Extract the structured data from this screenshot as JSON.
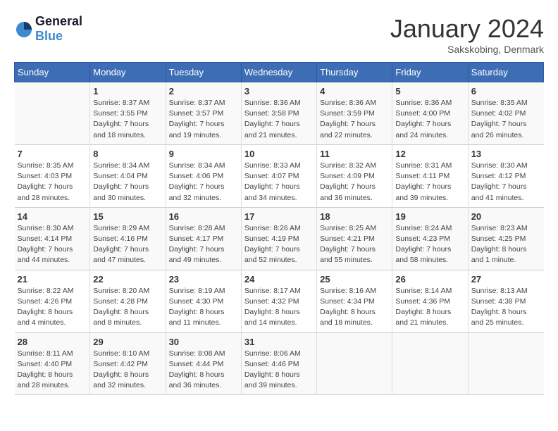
{
  "header": {
    "logo_general": "General",
    "logo_blue": "Blue",
    "month": "January 2024",
    "location": "Sakskobing, Denmark"
  },
  "weekdays": [
    "Sunday",
    "Monday",
    "Tuesday",
    "Wednesday",
    "Thursday",
    "Friday",
    "Saturday"
  ],
  "weeks": [
    [
      {
        "day": "",
        "info": ""
      },
      {
        "day": "1",
        "info": "Sunrise: 8:37 AM\nSunset: 3:55 PM\nDaylight: 7 hours\nand 18 minutes."
      },
      {
        "day": "2",
        "info": "Sunrise: 8:37 AM\nSunset: 3:57 PM\nDaylight: 7 hours\nand 19 minutes."
      },
      {
        "day": "3",
        "info": "Sunrise: 8:36 AM\nSunset: 3:58 PM\nDaylight: 7 hours\nand 21 minutes."
      },
      {
        "day": "4",
        "info": "Sunrise: 8:36 AM\nSunset: 3:59 PM\nDaylight: 7 hours\nand 22 minutes."
      },
      {
        "day": "5",
        "info": "Sunrise: 8:36 AM\nSunset: 4:00 PM\nDaylight: 7 hours\nand 24 minutes."
      },
      {
        "day": "6",
        "info": "Sunrise: 8:35 AM\nSunset: 4:02 PM\nDaylight: 7 hours\nand 26 minutes."
      }
    ],
    [
      {
        "day": "7",
        "info": "Sunrise: 8:35 AM\nSunset: 4:03 PM\nDaylight: 7 hours\nand 28 minutes."
      },
      {
        "day": "8",
        "info": "Sunrise: 8:34 AM\nSunset: 4:04 PM\nDaylight: 7 hours\nand 30 minutes."
      },
      {
        "day": "9",
        "info": "Sunrise: 8:34 AM\nSunset: 4:06 PM\nDaylight: 7 hours\nand 32 minutes."
      },
      {
        "day": "10",
        "info": "Sunrise: 8:33 AM\nSunset: 4:07 PM\nDaylight: 7 hours\nand 34 minutes."
      },
      {
        "day": "11",
        "info": "Sunrise: 8:32 AM\nSunset: 4:09 PM\nDaylight: 7 hours\nand 36 minutes."
      },
      {
        "day": "12",
        "info": "Sunrise: 8:31 AM\nSunset: 4:11 PM\nDaylight: 7 hours\nand 39 minutes."
      },
      {
        "day": "13",
        "info": "Sunrise: 8:30 AM\nSunset: 4:12 PM\nDaylight: 7 hours\nand 41 minutes."
      }
    ],
    [
      {
        "day": "14",
        "info": "Sunrise: 8:30 AM\nSunset: 4:14 PM\nDaylight: 7 hours\nand 44 minutes."
      },
      {
        "day": "15",
        "info": "Sunrise: 8:29 AM\nSunset: 4:16 PM\nDaylight: 7 hours\nand 47 minutes."
      },
      {
        "day": "16",
        "info": "Sunrise: 8:28 AM\nSunset: 4:17 PM\nDaylight: 7 hours\nand 49 minutes."
      },
      {
        "day": "17",
        "info": "Sunrise: 8:26 AM\nSunset: 4:19 PM\nDaylight: 7 hours\nand 52 minutes."
      },
      {
        "day": "18",
        "info": "Sunrise: 8:25 AM\nSunset: 4:21 PM\nDaylight: 7 hours\nand 55 minutes."
      },
      {
        "day": "19",
        "info": "Sunrise: 8:24 AM\nSunset: 4:23 PM\nDaylight: 7 hours\nand 58 minutes."
      },
      {
        "day": "20",
        "info": "Sunrise: 8:23 AM\nSunset: 4:25 PM\nDaylight: 8 hours\nand 1 minute."
      }
    ],
    [
      {
        "day": "21",
        "info": "Sunrise: 8:22 AM\nSunset: 4:26 PM\nDaylight: 8 hours\nand 4 minutes."
      },
      {
        "day": "22",
        "info": "Sunrise: 8:20 AM\nSunset: 4:28 PM\nDaylight: 8 hours\nand 8 minutes."
      },
      {
        "day": "23",
        "info": "Sunrise: 8:19 AM\nSunset: 4:30 PM\nDaylight: 8 hours\nand 11 minutes."
      },
      {
        "day": "24",
        "info": "Sunrise: 8:17 AM\nSunset: 4:32 PM\nDaylight: 8 hours\nand 14 minutes."
      },
      {
        "day": "25",
        "info": "Sunrise: 8:16 AM\nSunset: 4:34 PM\nDaylight: 8 hours\nand 18 minutes."
      },
      {
        "day": "26",
        "info": "Sunrise: 8:14 AM\nSunset: 4:36 PM\nDaylight: 8 hours\nand 21 minutes."
      },
      {
        "day": "27",
        "info": "Sunrise: 8:13 AM\nSunset: 4:38 PM\nDaylight: 8 hours\nand 25 minutes."
      }
    ],
    [
      {
        "day": "28",
        "info": "Sunrise: 8:11 AM\nSunset: 4:40 PM\nDaylight: 8 hours\nand 28 minutes."
      },
      {
        "day": "29",
        "info": "Sunrise: 8:10 AM\nSunset: 4:42 PM\nDaylight: 8 hours\nand 32 minutes."
      },
      {
        "day": "30",
        "info": "Sunrise: 8:08 AM\nSunset: 4:44 PM\nDaylight: 8 hours\nand 36 minutes."
      },
      {
        "day": "31",
        "info": "Sunrise: 8:06 AM\nSunset: 4:46 PM\nDaylight: 8 hours\nand 39 minutes."
      },
      {
        "day": "",
        "info": ""
      },
      {
        "day": "",
        "info": ""
      },
      {
        "day": "",
        "info": ""
      }
    ]
  ]
}
